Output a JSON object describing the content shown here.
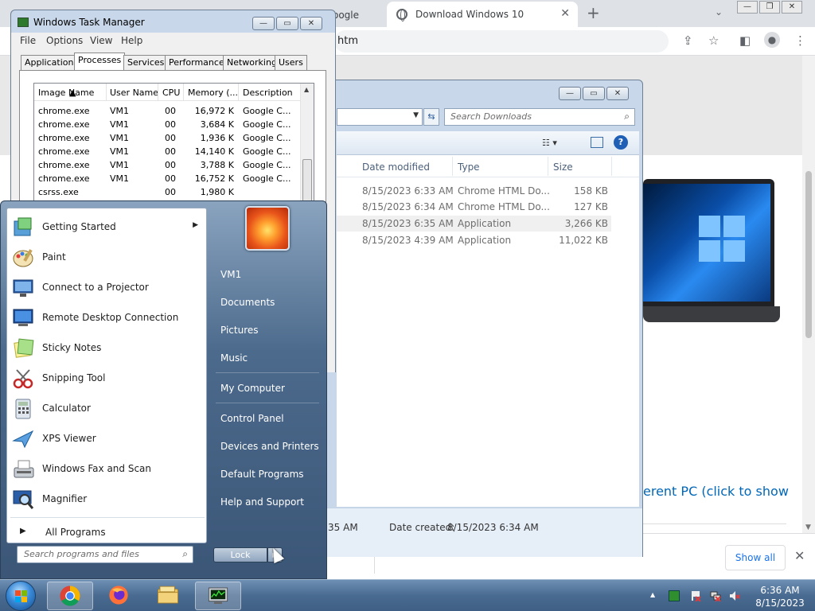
{
  "chrome": {
    "partial_tab_text": "oogle",
    "active_tab_title": "Download Windows 10",
    "new_tab_label": "+",
    "address_partial": "htm",
    "cta_text_partial": "erent PC (click to show",
    "show_all_label": "Show all"
  },
  "explorer": {
    "search_placeholder": "Search Downloads",
    "columns": {
      "date_modified": "Date modified",
      "type": "Type",
      "size": "Size"
    },
    "rows": [
      {
        "date": "8/15/2023 6:33 AM",
        "type": "Chrome HTML Do...",
        "size": "158 KB"
      },
      {
        "date": "8/15/2023 6:34 AM",
        "type": "Chrome HTML Do...",
        "size": "127 KB"
      },
      {
        "date": "8/15/2023 6:35 AM",
        "type": "Application",
        "size": "3,266 KB"
      },
      {
        "date": "8/15/2023 4:39 AM",
        "type": "Application",
        "size": "11,022 KB"
      }
    ],
    "details_partial_modified": ":35 AM",
    "details_created_label": "Date created:",
    "details_created_value": "8/15/2023 6:34 AM"
  },
  "taskmgr": {
    "title": "Windows Task Manager",
    "menu": {
      "file": "File",
      "options": "Options",
      "view": "View",
      "help": "Help"
    },
    "tabs": {
      "applications": "Applications",
      "processes": "Processes",
      "services": "Services",
      "performance": "Performance",
      "networking": "Networking",
      "users": "Users"
    },
    "columns": {
      "image_name": "Image Name",
      "user_name": "User Name",
      "cpu": "CPU",
      "memory": "Memory (...",
      "description": "Description"
    },
    "processes": [
      {
        "name": "chrome.exe",
        "user": "VM1",
        "cpu": "00",
        "mem": "16,972 K",
        "desc": "Google C..."
      },
      {
        "name": "chrome.exe",
        "user": "VM1",
        "cpu": "00",
        "mem": "3,684 K",
        "desc": "Google C..."
      },
      {
        "name": "chrome.exe",
        "user": "VM1",
        "cpu": "00",
        "mem": "1,936 K",
        "desc": "Google C..."
      },
      {
        "name": "chrome.exe",
        "user": "VM1",
        "cpu": "00",
        "mem": "14,140 K",
        "desc": "Google C..."
      },
      {
        "name": "chrome.exe",
        "user": "VM1",
        "cpu": "00",
        "mem": "3,788 K",
        "desc": "Google C..."
      },
      {
        "name": "chrome.exe",
        "user": "VM1",
        "cpu": "00",
        "mem": "16,752 K",
        "desc": "Google C..."
      },
      {
        "name": "csrss.exe",
        "user": "",
        "cpu": "00",
        "mem": "1,980 K",
        "desc": ""
      }
    ]
  },
  "startmenu": {
    "programs": [
      {
        "label": "Getting Started",
        "icon": "getting-started-icon",
        "has_submenu": true
      },
      {
        "label": "Paint",
        "icon": "paint-icon"
      },
      {
        "label": "Connect to a Projector",
        "icon": "projector-icon"
      },
      {
        "label": "Remote Desktop Connection",
        "icon": "remote-desktop-icon"
      },
      {
        "label": "Sticky Notes",
        "icon": "sticky-notes-icon"
      },
      {
        "label": "Snipping Tool",
        "icon": "snipping-tool-icon"
      },
      {
        "label": "Calculator",
        "icon": "calculator-icon"
      },
      {
        "label": "XPS Viewer",
        "icon": "xps-viewer-icon"
      },
      {
        "label": "Windows Fax and Scan",
        "icon": "fax-scan-icon"
      },
      {
        "label": "Magnifier",
        "icon": "magnifier-icon"
      }
    ],
    "all_programs": "All Programs",
    "search_placeholder": "Search programs and files",
    "right_items": {
      "user": "VM1",
      "documents": "Documents",
      "pictures": "Pictures",
      "music": "Music",
      "my_computer": "My Computer",
      "control_panel": "Control Panel",
      "devices_printers": "Devices and Printers",
      "default_programs": "Default Programs",
      "help_support": "Help and Support"
    },
    "lock_label": "Lock"
  },
  "taskbar": {
    "pinned": [
      "chrome-icon",
      "firefox-icon",
      "file-explorer-icon",
      "task-manager-icon"
    ],
    "clock_time": "6:36 AM",
    "clock_date": "8/15/2023"
  },
  "colors": {
    "taskbar": "#4a6b91",
    "startmenu_right": "#4c6a8c",
    "link_blue": "#0067b8",
    "window_frame": "#c8d8ea"
  }
}
